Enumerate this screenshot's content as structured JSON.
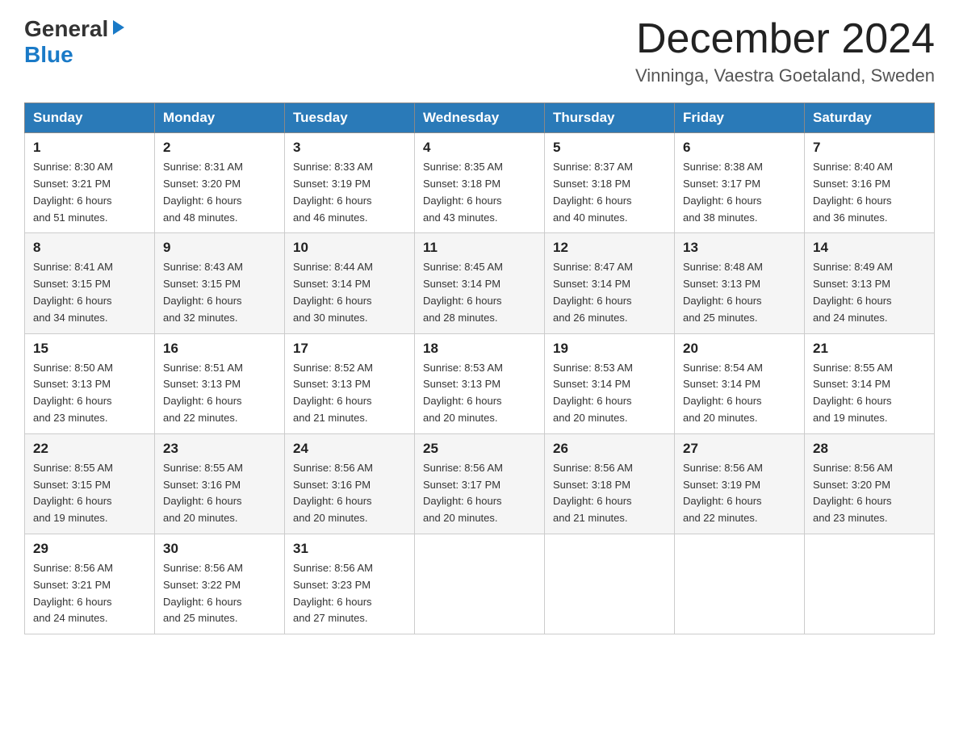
{
  "header": {
    "logo_general": "General",
    "logo_blue": "Blue",
    "month_title": "December 2024",
    "location": "Vinninga, Vaestra Goetaland, Sweden"
  },
  "days_of_week": [
    "Sunday",
    "Monday",
    "Tuesday",
    "Wednesday",
    "Thursday",
    "Friday",
    "Saturday"
  ],
  "weeks": [
    [
      {
        "day": "1",
        "sunrise": "8:30 AM",
        "sunset": "3:21 PM",
        "daylight": "6 hours and 51 minutes."
      },
      {
        "day": "2",
        "sunrise": "8:31 AM",
        "sunset": "3:20 PM",
        "daylight": "6 hours and 48 minutes."
      },
      {
        "day": "3",
        "sunrise": "8:33 AM",
        "sunset": "3:19 PM",
        "daylight": "6 hours and 46 minutes."
      },
      {
        "day": "4",
        "sunrise": "8:35 AM",
        "sunset": "3:18 PM",
        "daylight": "6 hours and 43 minutes."
      },
      {
        "day": "5",
        "sunrise": "8:37 AM",
        "sunset": "3:18 PM",
        "daylight": "6 hours and 40 minutes."
      },
      {
        "day": "6",
        "sunrise": "8:38 AM",
        "sunset": "3:17 PM",
        "daylight": "6 hours and 38 minutes."
      },
      {
        "day": "7",
        "sunrise": "8:40 AM",
        "sunset": "3:16 PM",
        "daylight": "6 hours and 36 minutes."
      }
    ],
    [
      {
        "day": "8",
        "sunrise": "8:41 AM",
        "sunset": "3:15 PM",
        "daylight": "6 hours and 34 minutes."
      },
      {
        "day": "9",
        "sunrise": "8:43 AM",
        "sunset": "3:15 PM",
        "daylight": "6 hours and 32 minutes."
      },
      {
        "day": "10",
        "sunrise": "8:44 AM",
        "sunset": "3:14 PM",
        "daylight": "6 hours and 30 minutes."
      },
      {
        "day": "11",
        "sunrise": "8:45 AM",
        "sunset": "3:14 PM",
        "daylight": "6 hours and 28 minutes."
      },
      {
        "day": "12",
        "sunrise": "8:47 AM",
        "sunset": "3:14 PM",
        "daylight": "6 hours and 26 minutes."
      },
      {
        "day": "13",
        "sunrise": "8:48 AM",
        "sunset": "3:13 PM",
        "daylight": "6 hours and 25 minutes."
      },
      {
        "day": "14",
        "sunrise": "8:49 AM",
        "sunset": "3:13 PM",
        "daylight": "6 hours and 24 minutes."
      }
    ],
    [
      {
        "day": "15",
        "sunrise": "8:50 AM",
        "sunset": "3:13 PM",
        "daylight": "6 hours and 23 minutes."
      },
      {
        "day": "16",
        "sunrise": "8:51 AM",
        "sunset": "3:13 PM",
        "daylight": "6 hours and 22 minutes."
      },
      {
        "day": "17",
        "sunrise": "8:52 AM",
        "sunset": "3:13 PM",
        "daylight": "6 hours and 21 minutes."
      },
      {
        "day": "18",
        "sunrise": "8:53 AM",
        "sunset": "3:13 PM",
        "daylight": "6 hours and 20 minutes."
      },
      {
        "day": "19",
        "sunrise": "8:53 AM",
        "sunset": "3:14 PM",
        "daylight": "6 hours and 20 minutes."
      },
      {
        "day": "20",
        "sunrise": "8:54 AM",
        "sunset": "3:14 PM",
        "daylight": "6 hours and 20 minutes."
      },
      {
        "day": "21",
        "sunrise": "8:55 AM",
        "sunset": "3:14 PM",
        "daylight": "6 hours and 19 minutes."
      }
    ],
    [
      {
        "day": "22",
        "sunrise": "8:55 AM",
        "sunset": "3:15 PM",
        "daylight": "6 hours and 19 minutes."
      },
      {
        "day": "23",
        "sunrise": "8:55 AM",
        "sunset": "3:16 PM",
        "daylight": "6 hours and 20 minutes."
      },
      {
        "day": "24",
        "sunrise": "8:56 AM",
        "sunset": "3:16 PM",
        "daylight": "6 hours and 20 minutes."
      },
      {
        "day": "25",
        "sunrise": "8:56 AM",
        "sunset": "3:17 PM",
        "daylight": "6 hours and 20 minutes."
      },
      {
        "day": "26",
        "sunrise": "8:56 AM",
        "sunset": "3:18 PM",
        "daylight": "6 hours and 21 minutes."
      },
      {
        "day": "27",
        "sunrise": "8:56 AM",
        "sunset": "3:19 PM",
        "daylight": "6 hours and 22 minutes."
      },
      {
        "day": "28",
        "sunrise": "8:56 AM",
        "sunset": "3:20 PM",
        "daylight": "6 hours and 23 minutes."
      }
    ],
    [
      {
        "day": "29",
        "sunrise": "8:56 AM",
        "sunset": "3:21 PM",
        "daylight": "6 hours and 24 minutes."
      },
      {
        "day": "30",
        "sunrise": "8:56 AM",
        "sunset": "3:22 PM",
        "daylight": "6 hours and 25 minutes."
      },
      {
        "day": "31",
        "sunrise": "8:56 AM",
        "sunset": "3:23 PM",
        "daylight": "6 hours and 27 minutes."
      },
      null,
      null,
      null,
      null
    ]
  ],
  "labels": {
    "sunrise": "Sunrise:",
    "sunset": "Sunset:",
    "daylight": "Daylight:"
  }
}
